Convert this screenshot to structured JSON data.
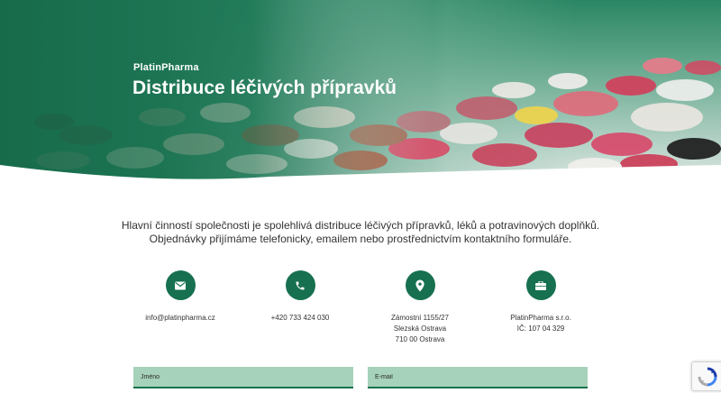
{
  "hero": {
    "brand": "PlatinPharma",
    "title": "Distribuce léčivých přípravků"
  },
  "intro": {
    "line1": "Hlavní činností společnosti je spolehlivá distribuce léčivých přípravků, léků a potravinových doplňků.",
    "line2": "Objednávky přijímáme telefonicky, emailem nebo prostřednictvím kontaktního formuláře."
  },
  "contacts": [
    {
      "icon": "envelope-icon",
      "lines": [
        "info@platinpharma.cz"
      ]
    },
    {
      "icon": "phone-icon",
      "lines": [
        "+420 733 424 030"
      ]
    },
    {
      "icon": "map-pin-icon",
      "lines": [
        "Zámostní 1155/27",
        "Slezská Ostrava",
        "710 00 Ostrava"
      ]
    },
    {
      "icon": "briefcase-icon",
      "lines": [
        "PlatinPharma s.r.o.",
        "IČ: 107 04 329"
      ]
    }
  ],
  "form": {
    "name_placeholder": "Jméno",
    "email_placeholder": "E-mail"
  },
  "colors": {
    "brand_green": "#17704f",
    "field_green": "#a6d1ba"
  }
}
